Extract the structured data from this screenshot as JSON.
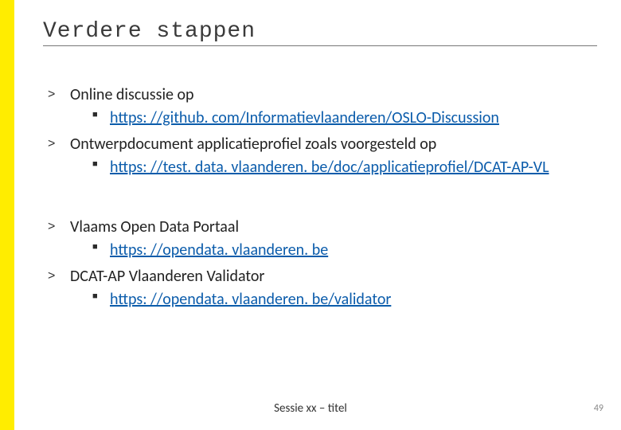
{
  "title": "Verdere stappen",
  "items": [
    {
      "text": "Online discussie op",
      "sub": {
        "link": "https: //github. com/Informatievlaanderen/OSLO-Discussion"
      }
    },
    {
      "text": "Ontwerpdocument applicatieprofiel zoals voorgesteld op",
      "sub": {
        "link": "https: //test. data. vlaanderen. be/doc/applicatieprofiel/DCAT-AP-VL"
      }
    },
    {
      "text": "Vlaams Open Data Portaal",
      "sub": {
        "link": "https: //opendata. vlaanderen. be"
      }
    },
    {
      "text": "DCAT-AP Vlaanderen Validator",
      "sub": {
        "link": "https: //opendata. vlaanderen. be/validator"
      }
    }
  ],
  "footer_center": "Sessie xx – titel",
  "footer_right": "49"
}
